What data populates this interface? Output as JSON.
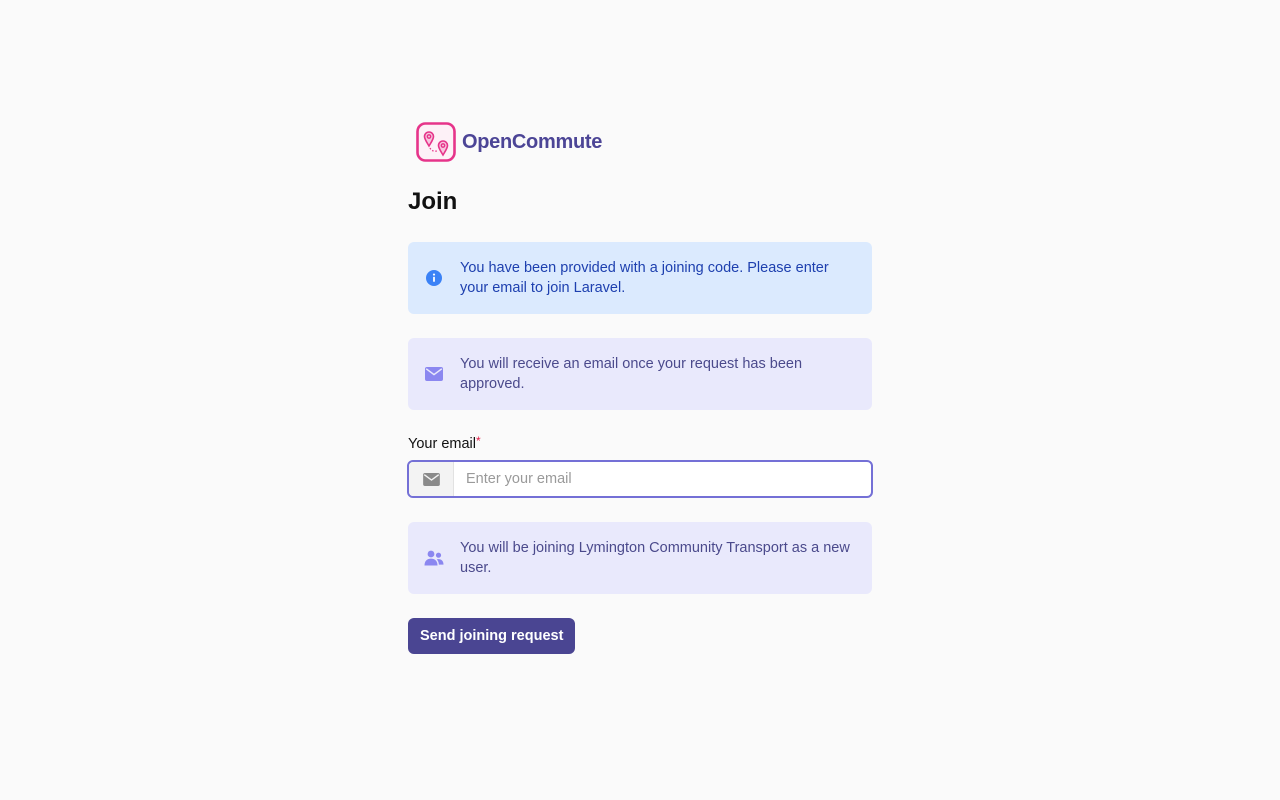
{
  "brand": {
    "name": "OpenCommute",
    "logo_icon": "map-pins-icon",
    "colors": {
      "logo": "#e6348a",
      "name": "#4c4596"
    }
  },
  "page": {
    "title": "Join"
  },
  "alerts": {
    "info": {
      "icon": "info-circle-icon",
      "text": "You have been provided with a joining code. Please enter your email to join Laravel."
    },
    "approval": {
      "icon": "envelope-icon",
      "text": "You will receive an email once your request has been approved."
    },
    "org": {
      "icon": "users-icon",
      "text": "You will be joining Lymington Community Transport as a new user."
    }
  },
  "form": {
    "email": {
      "label": "Your email",
      "required_mark": "*",
      "placeholder": "Enter your email",
      "value": "",
      "icon": "envelope-icon"
    },
    "submit_label": "Send joining request"
  },
  "colors": {
    "accent": "#4a4592",
    "focus_border": "#7470d6",
    "info_bg": "#dbeafe",
    "info_text": "#1e40af",
    "soft_bg": "#e9e9fc"
  }
}
